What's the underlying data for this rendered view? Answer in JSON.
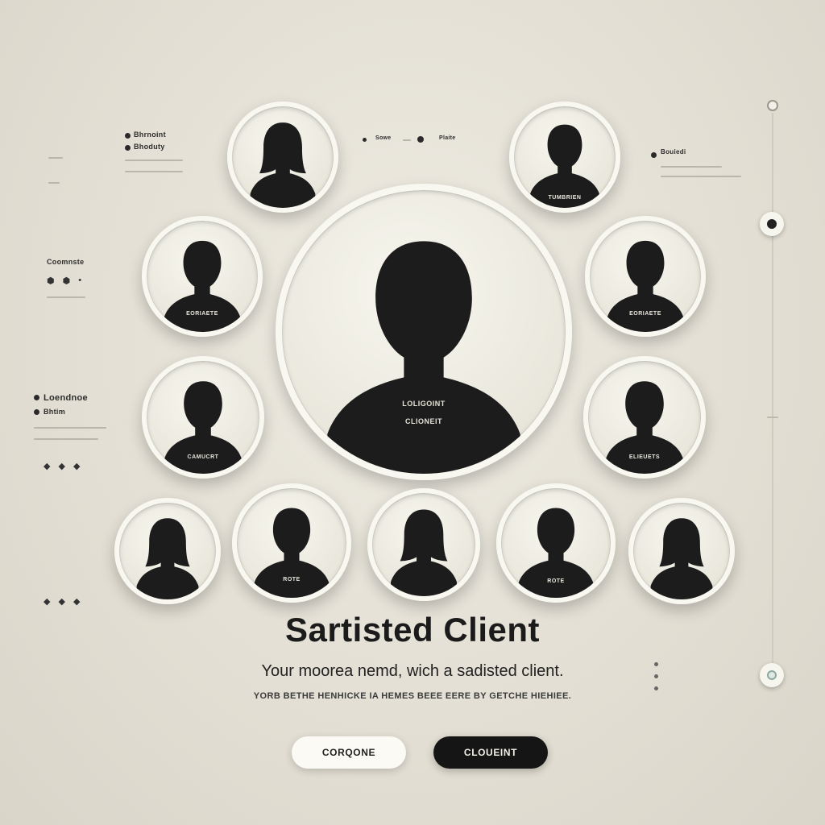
{
  "headline": {
    "title": "Sartisted Client",
    "subtitle": "Your moorea nemd, wich a sadisted client.",
    "small": "YORB BETHE HENHICKE IA HEMES BEEE EERE BY GETCHE HIEHIEE."
  },
  "buttons": {
    "primary_light": "CORQONE",
    "primary_dark": "CLOUEINT"
  },
  "left_panel": {
    "top_label_1": "Bhrnoint",
    "top_label_2": "Bhoduty",
    "mid_label": "Coomnste",
    "low_label_1": "Loendnoe",
    "low_label_2": "Bhtim"
  },
  "top_center_label": "Sowe",
  "top_center_label_2": "Plaite",
  "right_panel_label": "Bouiedi",
  "avatars": {
    "big_caption_1": "LOLIGOINT",
    "big_caption_2": "CLIONEIT",
    "caption_a": "TUMBRIEN",
    "caption_b": "EORIAETE",
    "caption_c": "CAMUCRT",
    "caption_d": "ELIEUETS",
    "caption_e": "ROTE"
  },
  "icons": {
    "shield": "shield-icon",
    "slider": "slider-icon",
    "star": "star-icon"
  },
  "colors": {
    "background": "#e2ded3",
    "dark": "#151515",
    "light": "#fbfaf4"
  }
}
